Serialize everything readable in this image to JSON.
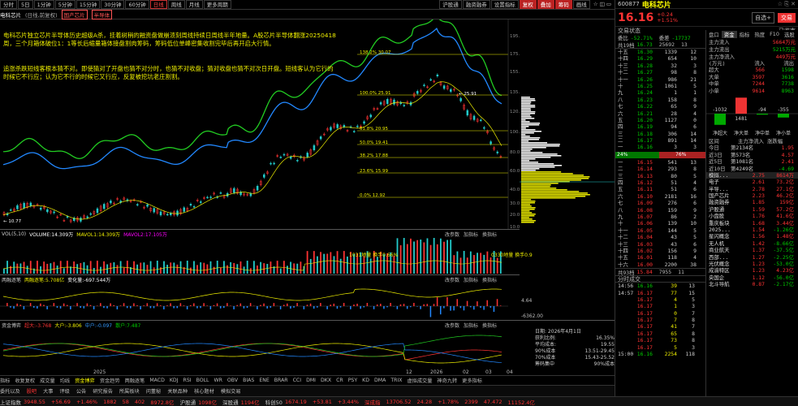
{
  "toolbar": {
    "items": [
      {
        "label": "分时",
        "on": false
      },
      {
        "label": "5日",
        "on": false
      },
      {
        "label": "1分钟",
        "on": false
      },
      {
        "label": "5分钟",
        "on": false
      },
      {
        "label": "15分钟",
        "on": false
      },
      {
        "label": "30分钟",
        "on": false
      },
      {
        "label": "60分钟",
        "on": false
      },
      {
        "label": "日线",
        "on": true
      },
      {
        "label": "周线",
        "on": false
      },
      {
        "label": "月线",
        "on": false
      },
      {
        "label": "更多周期",
        "on": false
      }
    ],
    "right": [
      "沪股通",
      "融资融券",
      "设置指标"
    ],
    "right2": [
      "复权",
      "叠加",
      "筹码"
    ],
    "btn": "画线",
    "icons": "☆ ◫ ▭"
  },
  "header": {
    "name": "电科芯片",
    "tags": [
      "(日线,前复权)",
      "国产芯片",
      "半导体"
    ]
  },
  "chart": {
    "annotation1": "电科芯片独立芯片半导体历史超级A杀，挂着树稍的融资盘做崩溃刻周线持续日周线半年地量。A股芯片半导体翻涨20250418周，三个月箱体破位1：1等长后缩量箱体接盘割肉筹码，筹码低位单峰密集收割完毕后再开启大行情。",
    "annotation2": "追涨杀跌短线客根本猜不对。即使猜对了开盘也猜不对分时，也猜不对收盘；猜对收盘也猜不对次日开盘。短线客认为它行的时候它不行应；认为它不行的时候它又行应，反复被挖坑老庄割割。",
    "fib": [
      "138.2% 30.07",
      "100.0% 25.91",
      "61.8% 20.95",
      "50.0% 19.41",
      "38.2% 17.88",
      "23.6% 15.99",
      "0.0% 12.92"
    ],
    "peak": "25.91",
    "low": "10.77",
    "yticks": [
      "195.00",
      "175.00",
      "155.00",
      "135.00",
      "120.00",
      "100.00",
      "80.00",
      "60.00",
      "40.00",
      "30.00",
      "20.00",
      "10.00"
    ]
  },
  "panels": {
    "vol": {
      "label": "VOL(5,10)",
      "v1": "VOLUME:14.309万",
      "v2": "MAVOL1:14.309万",
      "v3": "MAVOL2:17.105万",
      "note1": "1031地量 换手0.66%",
      "note2": "0330地量 换手0.9",
      "btns": [
        "改参数",
        "加指标",
        "换指标"
      ],
      "y": "2"
    },
    "rong": {
      "label": "两融逐笔",
      "v1": "两融逐笔:5.708亿",
      "v2": "变化量:-697.544万",
      "y1": "4.64",
      "y2": "-6362.00",
      "btns": [
        "改参数",
        "加指标",
        "换指标"
      ]
    },
    "fund": {
      "label": "资金博弈",
      "v1": "超大:-3.768",
      "v2": "大户:-3.806",
      "v3": "中户:-0.097",
      "v4": "散户:7.487",
      "btns": [
        "改参数",
        "加指标",
        "换指标"
      ]
    }
  },
  "infobox": {
    "date": "日期: 2026年4月1日",
    "l1": "获利比例:",
    "v1": "16.35%",
    "l2": "平均成本:",
    "v2": "19.55",
    "l3": "90%成本",
    "v3": "13.51-29.45",
    "l4": "70%成本",
    "v4": "15.43-25.52",
    "l5": "筹码集中",
    "v5": "90%成本"
  },
  "indicator_tabs": [
    "指标",
    "收复复权",
    "成交量",
    "均线",
    "资金博弈",
    "资金趋势",
    "两融逐笔",
    "MACD",
    "KDJ",
    "RSI",
    "BOLL",
    "WR",
    "OBV",
    "BIAS",
    "ENE",
    "BRAR",
    "CCI",
    "DMI",
    "DKX",
    "CR",
    "PSY",
    "KD",
    "DMA",
    "TRIX",
    "虚拟成交量",
    "神奇九转",
    "更多指标"
  ],
  "xaxis": [
    "2025",
    "2026",
    "12",
    "02",
    "03",
    "04"
  ],
  "ticker": [
    {
      "a": "深成指",
      "b": "13706.52",
      "c": "24.28",
      "d": "+1.78%"
    },
    {
      "a": "",
      "b": "2399",
      "c": "47.472",
      "d": ""
    },
    {
      "a": "",
      "b": "11152.4亿",
      "c": "",
      "d": ""
    }
  ],
  "bottombar": [
    {
      "t": "上证指数",
      "v": "3948.55"
    },
    {
      "t": "",
      "v": "+56.69"
    },
    {
      "t": "",
      "v": "+1.46%"
    },
    {
      "t": "",
      "v": "1882"
    },
    {
      "t": "",
      "v": "58"
    },
    {
      "t": "",
      "v": "402"
    },
    {
      "t": "",
      "v": "8972.8亿"
    },
    {
      "t": "沪股通",
      "v": "1098亿"
    },
    {
      "t": "深股通",
      "v": "1194亿"
    },
    {
      "t": "科创50",
      "v": "1674.19"
    },
    {
      "t": "",
      "v": "+53.81"
    },
    {
      "t": "",
      "v": "+3.44%"
    }
  ],
  "tabs_bottom": [
    "委托以及",
    "股吧",
    "大事",
    "评级",
    "公告",
    "研究报告",
    "所属板块",
    "问董秘",
    "关联品种",
    "核心题材",
    "模拟交易"
  ],
  "side": {
    "code": "600877",
    "name": "电科芯片",
    "price": "16.16",
    "chg": "+0.24",
    "pct": "+1.51%",
    "btn1": "自选+",
    "btn2": "交易",
    "status": "交易状态",
    "status2": "已收市",
    "weibi": "委比",
    "weibi_v": "-52.71%",
    "weicha": "委差",
    "weicha_v": "-17737",
    "gong": "共19档",
    "gong_v": "16.73",
    "gong_n": "25692",
    "gong_b": "13",
    "tabs": [
      "盘口",
      "资金",
      "指标",
      "热度",
      "F10",
      "选股"
    ],
    "sells": [
      [
        "十五",
        "16.30",
        "1339",
        "12"
      ],
      [
        "十四",
        "16.29",
        "654",
        "10"
      ],
      [
        "十三",
        "16.28",
        "32",
        "3"
      ],
      [
        "十二",
        "16.27",
        "98",
        "8"
      ],
      [
        "十一",
        "16.26",
        "986",
        "21"
      ],
      [
        "十",
        "16.25",
        "1061",
        "5"
      ],
      [
        "九",
        "16.24",
        "1",
        "1"
      ],
      [
        "八",
        "16.23",
        "158",
        "8"
      ],
      [
        "七",
        "16.22",
        "65",
        "9"
      ],
      [
        "六",
        "16.21",
        "28",
        "4"
      ],
      [
        "五",
        "16.20",
        "1127",
        "0"
      ],
      [
        "四",
        "16.19",
        "94",
        "6"
      ],
      [
        "三",
        "16.18",
        "306",
        "14"
      ],
      [
        "二",
        "16.17",
        "891",
        "14"
      ],
      [
        "一",
        "16.16",
        "3",
        "3"
      ]
    ],
    "ratio_l": "24%",
    "ratio_r": "76%",
    "buys": [
      [
        "一",
        "16.15",
        "541",
        "13"
      ],
      [
        "二",
        "16.14",
        "293",
        "8"
      ],
      [
        "三",
        "16.13",
        "80",
        "5"
      ],
      [
        "四",
        "16.12",
        "51",
        "4"
      ],
      [
        "五",
        "16.11",
        "51",
        "6"
      ],
      [
        "六",
        "16.10",
        "2181",
        "16"
      ],
      [
        "七",
        "16.09",
        "276",
        "6"
      ],
      [
        "八",
        "16.08",
        "159",
        "9"
      ],
      [
        "九",
        "16.07",
        "86",
        "2"
      ],
      [
        "十",
        "16.06",
        "139",
        "10"
      ],
      [
        "十一",
        "16.05",
        "144",
        "5"
      ],
      [
        "十二",
        "16.04",
        "43",
        "5"
      ],
      [
        "十三",
        "16.03",
        "43",
        "6"
      ],
      [
        "十四",
        "16.02",
        "156",
        "9"
      ],
      [
        "十五",
        "16.01",
        "118",
        "4"
      ],
      [
        "十六",
        "16.00",
        "2200",
        "38"
      ]
    ],
    "gong2": "共93档",
    "gong2_v": "15.84",
    "gong2_n": "7955",
    "gong2_b": "11",
    "flow": {
      "l1": "主力流入",
      "v1": "5664万元",
      "l2": "主力流出",
      "v2": "5215万元",
      "l3": "主力净流入",
      "v3": "449万元"
    },
    "flowtbl": {
      "h": [
        "(万元)",
        "流入",
        "流出"
      ],
      "rows": [
        [
          "超大",
          "566",
          "1598"
        ],
        [
          "大单",
          "3597",
          "3616"
        ],
        [
          "中单",
          "7244",
          "7738"
        ],
        [
          "小单",
          "9614",
          "8963"
        ]
      ]
    },
    "bars": [
      "-1032",
      "1481",
      "-94",
      "-355"
    ],
    "bar_values": [
      -1032,
      1481,
      -94,
      -355
    ],
    "bar_labels": [
      "净超大",
      "净大单",
      "净中单",
      "净小单"
    ],
    "cal": {
      "h": [
        "区间",
        "主力净流入",
        "涨跌幅"
      ],
      "rows": [
        [
          "今日",
          "1.95"
        ],
        [
          "近3日",
          "4.57"
        ],
        [
          "近5日",
          "2.41"
        ],
        [
          "近10日",
          "-4.69"
        ]
      ],
      "v": [
        "第2134名",
        "第573名",
        "第1081名",
        "第4249名"
      ]
    },
    "sector": [
      [
        "模拟...",
        "2.75",
        "8614万"
      ],
      [
        "电子",
        "2.61",
        "73.2亿"
      ],
      [
        "半导...",
        "2.78",
        "27.1亿"
      ],
      [
        "国产芯片",
        "2.23",
        "46.2亿"
      ],
      [
        "融资融券",
        "1.85",
        "159亿"
      ],
      [
        "沪股通",
        "1.59",
        "57.2亿"
      ],
      [
        "小盘股",
        "1.76",
        "41.6亿"
      ],
      [
        "重庆板块",
        "1.68",
        "3.44亿"
      ],
      [
        "2025...",
        "1.54",
        "-1.26亿"
      ],
      [
        "星闪概念",
        "1.56",
        "1.48亿"
      ],
      [
        "无人机",
        "1.42",
        "-8.66亿"
      ],
      [
        "商业航天",
        "1.37",
        "-37.5亿"
      ],
      [
        "西部...",
        "1.27",
        "-2.25亿"
      ],
      [
        "光伏概念",
        "1.23",
        "-53.0亿"
      ],
      [
        "成渝特区",
        "1.23",
        "4.23亿"
      ],
      [
        "央国企",
        "1.12",
        "-56.0亿"
      ],
      [
        "北斗导航",
        "0.87",
        "-2.17亿"
      ]
    ],
    "fenshi": "分时成交",
    "trades": [
      [
        "14:56",
        "16.16",
        "39",
        "13"
      ],
      [
        "14:57",
        "16.17",
        "77",
        "15"
      ],
      [
        "",
        "16.17",
        "4",
        "5"
      ],
      [
        "",
        "16.17",
        "1",
        "3"
      ],
      [
        "",
        "16.17",
        "0",
        "7"
      ],
      [
        "",
        "16.17",
        "7",
        "8"
      ],
      [
        "",
        "16.17",
        "41",
        "7"
      ],
      [
        "",
        "16.17",
        "65",
        "8"
      ],
      [
        "",
        "16.17",
        "73",
        "8"
      ],
      [
        "",
        "16.17",
        "5",
        "3"
      ],
      [
        "15:00",
        "16.16",
        "2254",
        "118"
      ]
    ]
  }
}
